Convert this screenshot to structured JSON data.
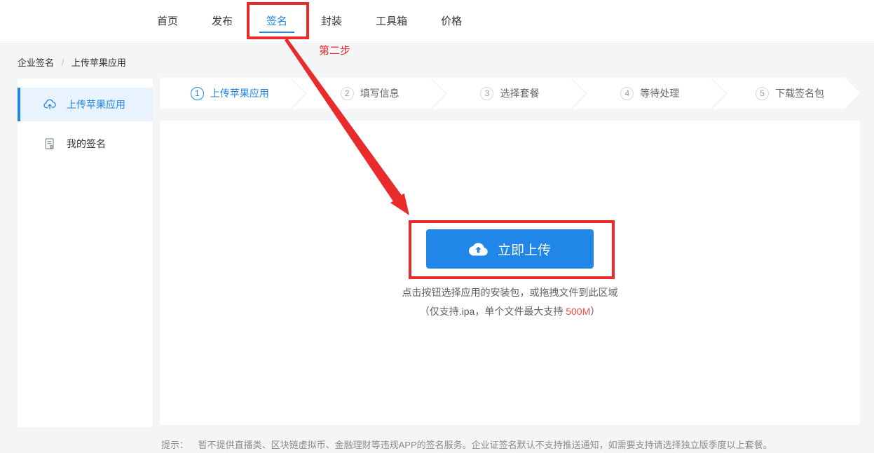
{
  "nav": {
    "tabs": [
      {
        "label": "首页"
      },
      {
        "label": "发布"
      },
      {
        "label": "签名",
        "active": true
      },
      {
        "label": "封装"
      },
      {
        "label": "工具箱"
      },
      {
        "label": "价格"
      }
    ]
  },
  "breadcrumb": {
    "parent": "企业签名",
    "separator": "/",
    "current": "上传苹果应用"
  },
  "sidebar": {
    "items": [
      {
        "label": "上传苹果应用",
        "icon": "cloud-upload-icon",
        "active": true
      },
      {
        "label": "我的签名",
        "icon": "signature-doc-icon",
        "active": false
      }
    ]
  },
  "steps": [
    {
      "number": "1",
      "label": "上传苹果应用",
      "active": true
    },
    {
      "number": "2",
      "label": "填写信息",
      "active": false
    },
    {
      "number": "3",
      "label": "选择套餐",
      "active": false
    },
    {
      "number": "4",
      "label": "等待处理",
      "active": false
    },
    {
      "number": "5",
      "label": "下载签名包",
      "active": false
    }
  ],
  "upload": {
    "button_label": "立即上传",
    "hint_line1": "点击按钮选择应用的安装包，或拖拽文件到此区域",
    "hint_line2_prefix": "（仅支持.ipa，单个文件最大支持 ",
    "hint_line2_highlight": "500M",
    "hint_line2_suffix": "）"
  },
  "footer_tip": {
    "label": "提示：",
    "text": "暂不提供直播类、区块链虚拟币、金融理财等违规APP的签名服务。企业证签名默认不支持推送通知，如需要支持请选择独立版季度以上套餐。"
  },
  "annotations": {
    "step_label": "第二步"
  },
  "colors": {
    "accent_blue": "#2086e8",
    "annotation_red": "#ea2b2b",
    "size_highlight_red": "#f5483b",
    "sidebar_active_bg": "#e8f3fd",
    "page_bg": "#f3f5f7"
  }
}
